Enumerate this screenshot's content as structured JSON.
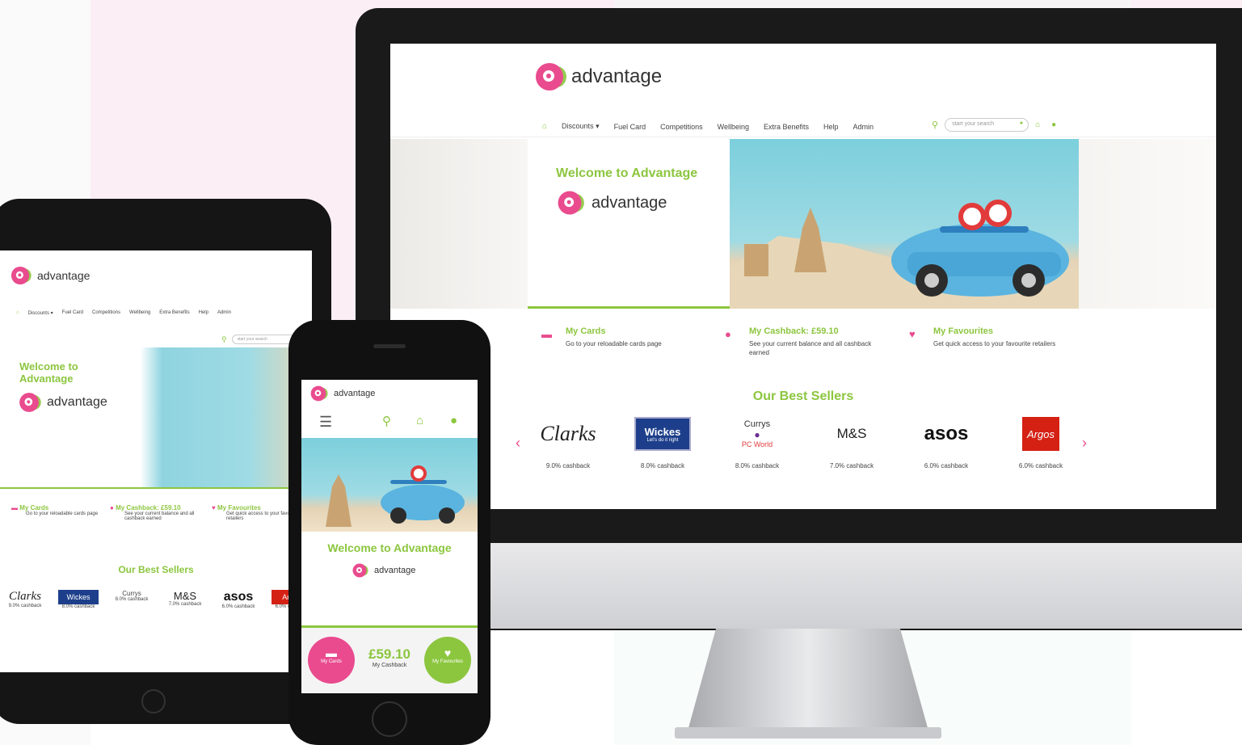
{
  "desktop": {
    "brand": "advantage",
    "nav": [
      "Discounts ▾",
      "Fuel Card",
      "Competitions",
      "Wellbeing",
      "Extra Benefits",
      "Help",
      "Admin"
    ],
    "search_placeholder": "start your search",
    "hero_title": "Welcome to Advantage",
    "hero_brand": "advantage",
    "info": [
      {
        "title": "My Cards",
        "desc": "Go to your reloadable cards page",
        "icon": "card-icon"
      },
      {
        "title": "My Cashback: £59.10",
        "desc": "See your current balance and all cashback earned",
        "icon": "piggy-bank-icon"
      },
      {
        "title": "My Favourites",
        "desc": "Get quick access to your favourite retailers",
        "icon": "heart-icon"
      }
    ],
    "best_sellers_title": "Our Best Sellers",
    "brands": [
      {
        "name": "Clarks",
        "cashback": "9.0% cashback"
      },
      {
        "name": "Wickes",
        "tagline": "Let's do it right",
        "cashback": "8.0% cashback"
      },
      {
        "name": "Currys",
        "sub": "PC World",
        "cashback": "8.0% cashback"
      },
      {
        "name": "M&S",
        "cashback": "7.0% cashback"
      },
      {
        "name": "asos",
        "cashback": "6.0% cashback"
      },
      {
        "name": "Argos",
        "cashback": "6.0% cashback"
      }
    ]
  },
  "tablet": {
    "brand": "advantage",
    "nav": [
      "Discounts ▾",
      "Fuel Card",
      "Competitions",
      "Wellbeing",
      "Extra Benefits",
      "Help",
      "Admin"
    ],
    "search_placeholder": "start your search",
    "hero_title": "Welcome to Advantage",
    "hero_brand": "advantage",
    "info": [
      {
        "title": "My Cards",
        "desc": "Go to your reloadable cards page"
      },
      {
        "title": "My Cashback: £59.10",
        "desc": "See your current balance and all cashback earned"
      },
      {
        "title": "My Favourites",
        "desc": "Get quick access to your favourite retailers"
      }
    ],
    "best_sellers_title": "Our Best Sellers",
    "brands": [
      {
        "name": "Clarks",
        "cashback": "9.0% cashback"
      },
      {
        "name": "Wickes",
        "cashback": "8.0% cashback"
      },
      {
        "name": "Currys",
        "cashback": "8.0% cashback"
      },
      {
        "name": "M&S",
        "cashback": "7.0% cashback"
      },
      {
        "name": "asos",
        "cashback": "6.0% cashback"
      },
      {
        "name": "Argos",
        "cashback": "6.0% cashback"
      }
    ]
  },
  "phone": {
    "brand": "advantage",
    "hero_title": "Welcome to Advantage",
    "hero_brand": "advantage",
    "cashback_amount": "£59.10",
    "cashback_label": "My Cashback",
    "cards_label": "My Cards",
    "favourites_label": "My Favourites"
  },
  "colors": {
    "accent_green": "#8cc63f",
    "accent_pink": "#e94b8e"
  }
}
